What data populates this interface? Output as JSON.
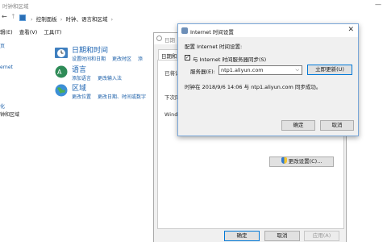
{
  "control_panel": {
    "window_title": "时钟和区域",
    "breadcrumb": [
      "控制面板",
      "时钟、语言和区域"
    ],
    "menu": [
      "查看(V)",
      "工具(T)"
    ],
    "menu_partial": "辑(E)",
    "sidebar": [
      "页",
      "ernet",
      "化",
      "钟和区域"
    ],
    "categories": [
      {
        "title": "日期和时间",
        "links": [
          "设置时间和日期",
          "更改时区",
          "添"
        ],
        "icon": "clock-icon"
      },
      {
        "title": "语言",
        "links": [
          "添加语言",
          "更改输入法"
        ],
        "icon": "language-icon"
      },
      {
        "title": "区域",
        "links": [
          "更改位置",
          "更改日期、时间或数字"
        ],
        "icon": "globe-icon"
      }
    ]
  },
  "datetime_dialog": {
    "title": "日期",
    "tab": "日期和时",
    "lines": [
      "已将计",
      "下次同",
      "Windo"
    ],
    "change_settings_button": "更改设置(C)...",
    "ok_button": "确定",
    "cancel_button": "取消",
    "apply_button": "应用(A)"
  },
  "internet_time_dialog": {
    "title": "Internet 时间设置",
    "heading": "配置 Internet 时间设置:",
    "sync_checkbox_label": "与 Internet 时间服务器同步(S)",
    "sync_checked": true,
    "server_label": "服务器(E):",
    "server_value": "ntp1.aliyun.com",
    "update_now_button": "立即更新(U)",
    "status_text": "时钟在 2018/9/6 14:06 与 ntp1.aliyun.com 同步成功。",
    "ok_button": "确定",
    "cancel_button": "取消"
  }
}
